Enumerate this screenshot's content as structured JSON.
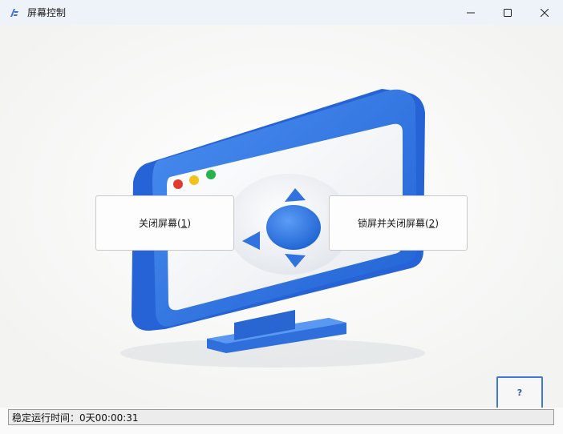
{
  "window": {
    "title": "屏幕控制",
    "app_icon": "app-logo-icon",
    "controls": [
      "minimize-icon",
      "maximize-icon",
      "close-icon"
    ]
  },
  "buttons": {
    "close_screen": {
      "text": "关闭屏幕(",
      "key": "1",
      "suffix": ")"
    },
    "lock_close_screen": {
      "text": "锁屏并关闭屏幕(",
      "key": "2",
      "suffix": ")"
    },
    "help": "?"
  },
  "status": {
    "uptime": "稳定运行时间：0天00:00:31"
  },
  "colors": {
    "accent": "#2f72e0",
    "help_border": "#3f78d6",
    "dot_red": "#e23b2e",
    "dot_yellow": "#f2c21b",
    "dot_green": "#27b34a"
  }
}
